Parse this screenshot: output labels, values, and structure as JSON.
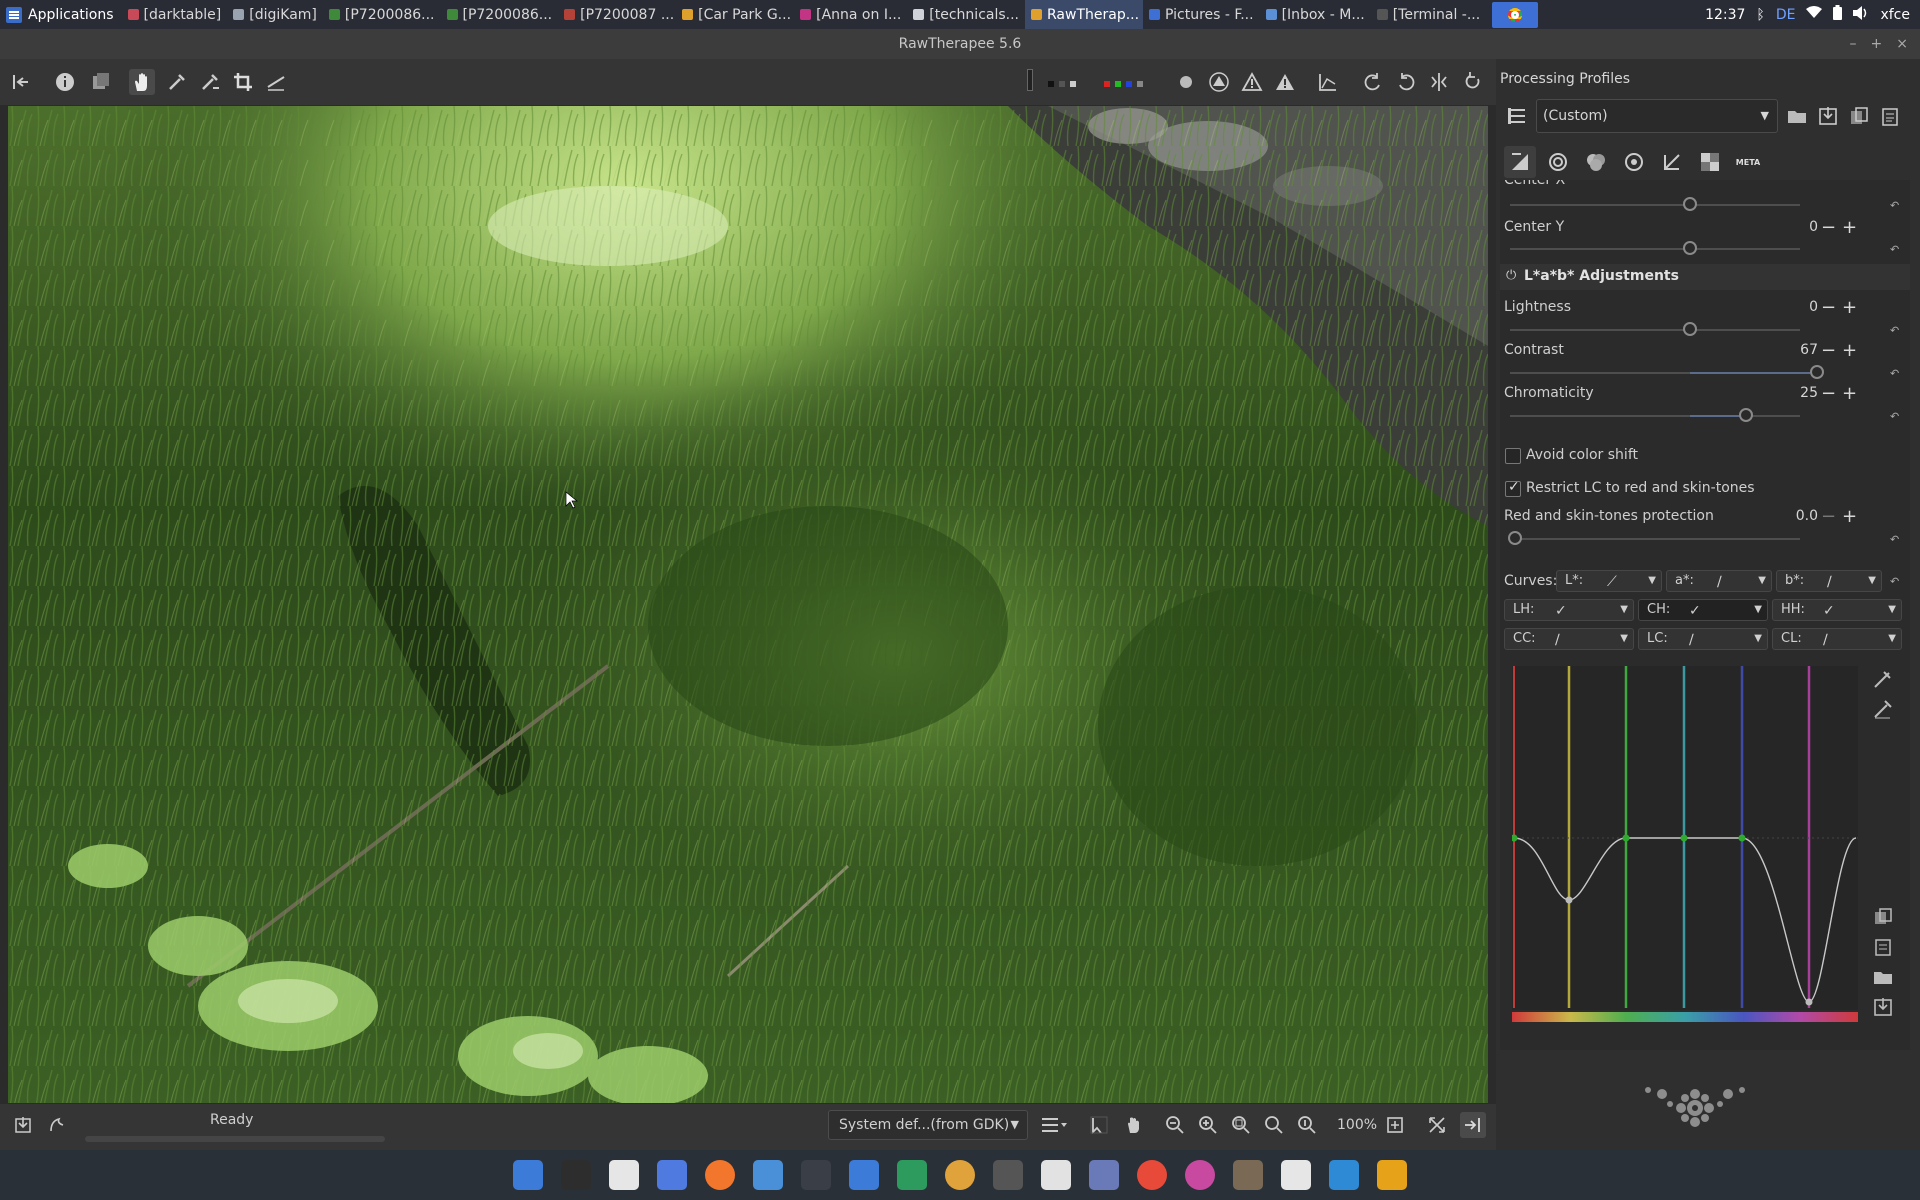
{
  "topbar": {
    "applications_label": "Applications",
    "tasks": [
      {
        "label": "[darktable]",
        "color": "#c84a58"
      },
      {
        "label": "[digiKam]",
        "color": "#9aa3b0"
      },
      {
        "label": "[P7200086...",
        "color": "#3f8a3a"
      },
      {
        "label": "[P7200086...",
        "color": "#3f8a3a"
      },
      {
        "label": "[P7200087 ...",
        "color": "#b54238"
      },
      {
        "label": "[Car Park G...",
        "color": "#e0a12c"
      },
      {
        "label": "[Anna on I...",
        "color": "#c13584"
      },
      {
        "label": "[technicals...",
        "color": "#cfd3d9"
      },
      {
        "label": "RawTherap...",
        "color": "#e0a12c",
        "active": true
      },
      {
        "label": "Pictures - F...",
        "color": "#3d6fd4"
      },
      {
        "label": "[Inbox - M...",
        "color": "#5b8fd6"
      },
      {
        "label": "[Terminal -...",
        "color": "#555555"
      }
    ],
    "clock": "12:37",
    "keyboard_layout": "DE",
    "session_label": "xfce"
  },
  "window": {
    "title": "RawTherapee 5.6",
    "controls": [
      "–",
      "+",
      "×"
    ]
  },
  "toolbar": {
    "left_icons": [
      "panel-toggle-icon",
      "info-icon",
      "before-after-icon",
      "hand-icon",
      "color-picker-icon",
      "wb-picker-icon",
      "crop-icon",
      "straighten-icon"
    ],
    "right_icons": [
      "focus-mask-icon",
      "clipped-shadows-icon",
      "clipped-highlights-icon",
      "warning-icon",
      "histogram-icon",
      "rotate-left-icon",
      "rotate-right-icon",
      "flip-h-icon",
      "flip-v-icon"
    ]
  },
  "status": {
    "text": "Ready",
    "profile_select": "System def...(from GDK)",
    "zoom": "100%"
  },
  "profiles": {
    "title": "Processing Profiles",
    "selected": "(Custom)"
  },
  "tool_tabs": [
    "exposure-tab-icon",
    "detail-tab-icon",
    "color-tab-icon",
    "advanced-tab-icon",
    "transform-tab-icon",
    "raw-tab-icon",
    "meta-tab-icon"
  ],
  "tool_tabs_meta_label": "META",
  "vignette": {
    "center_x_label": "Center X",
    "center_y_label": "Center Y",
    "center_y_value": "0"
  },
  "lab": {
    "section_title": "L*a*b* Adjustments",
    "lightness_label": "Lightness",
    "lightness_value": "0",
    "contrast_label": "Contrast",
    "contrast_value": "67",
    "chromaticity_label": "Chromaticity",
    "chromaticity_value": "25",
    "avoid_color_shift_label": "Avoid color shift",
    "avoid_color_shift_checked": false,
    "restrict_lc_label": "Restrict LC to red and skin-tones",
    "restrict_lc_checked": true,
    "red_skin_label": "Red and skin-tones protection",
    "red_skin_value": "0.0",
    "curves_label": "Curves:",
    "curve_buttons": [
      {
        "label": "L*:"
      },
      {
        "label": "a*:"
      },
      {
        "label": "b*:"
      },
      {
        "label": "LH:"
      },
      {
        "label": "CH:"
      },
      {
        "label": "HH:"
      },
      {
        "label": "CC:"
      },
      {
        "label": "LC:"
      },
      {
        "label": "CL:"
      }
    ]
  },
  "dock": {
    "icons": [
      "files-icon",
      "terminal-icon",
      "text-editor-icon",
      "safari-like-icon",
      "firefox-icon",
      "mail-icon",
      "search-icon",
      "folder-icon",
      "digikam-icon",
      "pinwheel-icon",
      "camera-icon",
      "color-wheel-icon",
      "screenshot-icon",
      "chrome-icon",
      "darktable-icon",
      "gimp-icon",
      "document-icon",
      "magnifier-icon",
      "download-icon"
    ]
  }
}
